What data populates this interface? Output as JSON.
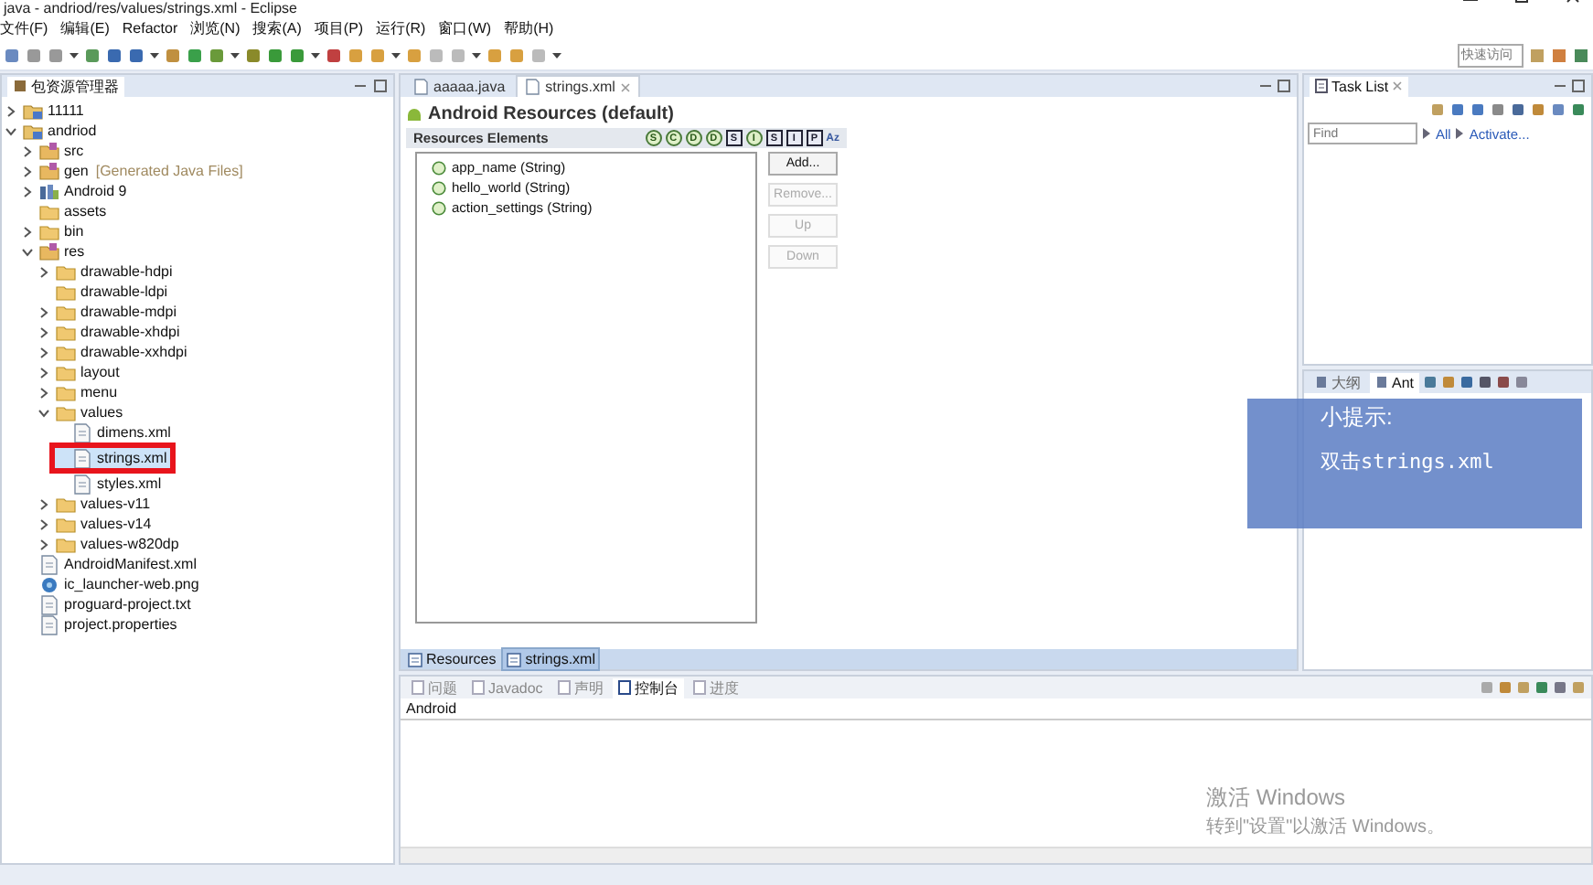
{
  "window": {
    "title": "java - andriod/res/values/strings.xml - Eclipse"
  },
  "menu": [
    "文件(F)",
    "编辑(E)",
    "Refactor",
    "浏览(N)",
    "搜索(A)",
    "项目(P)",
    "运行(R)",
    "窗口(W)",
    "帮助(H)"
  ],
  "quick_access": {
    "placeholder": "快速访问"
  },
  "explorer": {
    "title": "包资源管理器",
    "tree": [
      {
        "label": "11111",
        "kind": "project",
        "expanded": false
      },
      {
        "label": "andriod",
        "kind": "project",
        "expanded": true,
        "children": [
          {
            "label": "src",
            "kind": "package",
            "expanded": false
          },
          {
            "label": "gen",
            "decoration": "[Generated Java Files]",
            "kind": "package",
            "expanded": false
          },
          {
            "label": "Android 9",
            "kind": "library",
            "expanded": false
          },
          {
            "label": "assets",
            "kind": "folder"
          },
          {
            "label": "bin",
            "kind": "folder",
            "expanded": false
          },
          {
            "label": "res",
            "kind": "package",
            "expanded": true,
            "children": [
              {
                "label": "drawable-hdpi",
                "kind": "folder",
                "expanded": false
              },
              {
                "label": "drawable-ldpi",
                "kind": "folder"
              },
              {
                "label": "drawable-mdpi",
                "kind": "folder",
                "expanded": false
              },
              {
                "label": "drawable-xhdpi",
                "kind": "folder",
                "expanded": false
              },
              {
                "label": "drawable-xxhdpi",
                "kind": "folder",
                "expanded": false
              },
              {
                "label": "layout",
                "kind": "folder",
                "expanded": false
              },
              {
                "label": "menu",
                "kind": "folder",
                "expanded": false
              },
              {
                "label": "values",
                "kind": "folder",
                "expanded": true,
                "children": [
                  {
                    "label": "dimens.xml",
                    "kind": "file",
                    "selected": false
                  },
                  {
                    "label": "strings.xml",
                    "kind": "file",
                    "selected": true,
                    "highlighted": true
                  },
                  {
                    "label": "styles.xml",
                    "kind": "file",
                    "selected": false
                  }
                ]
              },
              {
                "label": "values-v11",
                "kind": "folder",
                "expanded": false
              },
              {
                "label": "values-v14",
                "kind": "folder",
                "expanded": false
              },
              {
                "label": "values-w820dp",
                "kind": "folder",
                "expanded": false
              }
            ]
          },
          {
            "label": "AndroidManifest.xml",
            "kind": "file"
          },
          {
            "label": "ic_launcher-web.png",
            "kind": "image"
          },
          {
            "label": "proguard-project.txt",
            "kind": "file"
          },
          {
            "label": "project.properties",
            "kind": "file"
          }
        ]
      }
    ]
  },
  "editor": {
    "tabs": [
      {
        "label": "aaaaa.java",
        "selected": false
      },
      {
        "label": "strings.xml",
        "selected": true
      }
    ],
    "heading": "Android Resources (default)",
    "section": "Resources Elements",
    "filters": [
      "S",
      "C",
      "D",
      "D",
      "S",
      "I",
      "S",
      "I",
      "P",
      "Az"
    ],
    "elements": [
      {
        "label": "app_name (String)"
      },
      {
        "label": "hello_world (String)"
      },
      {
        "label": "action_settings (String)"
      }
    ],
    "buttons": [
      {
        "label": "Add...",
        "disabled": false
      },
      {
        "label": "Remove...",
        "disabled": true
      },
      {
        "label": "Up",
        "disabled": true
      },
      {
        "label": "Down",
        "disabled": true
      }
    ],
    "bottom_tabs": [
      {
        "label": "Resources",
        "selected": false
      },
      {
        "label": "strings.xml",
        "selected": true
      }
    ]
  },
  "task_list": {
    "title": "Task List",
    "find": {
      "placeholder": "Find"
    },
    "links": [
      "All",
      "Activate..."
    ]
  },
  "outline": {
    "tabs": [
      {
        "label": "大纲",
        "selected": false
      },
      {
        "label": "Ant",
        "selected": true
      }
    ]
  },
  "hint": {
    "title": "小提示:",
    "text": "双击strings.xml"
  },
  "console": {
    "tabs": [
      {
        "label": "问题",
        "selected": false
      },
      {
        "label": "Javadoc",
        "selected": false
      },
      {
        "label": "声明",
        "selected": false
      },
      {
        "label": "控制台",
        "selected": true
      },
      {
        "label": "进度",
        "selected": false
      }
    ],
    "header": "Android"
  },
  "activation": {
    "title": "激活 Windows",
    "text": "转到\"设置\"以激活 Windows。"
  }
}
